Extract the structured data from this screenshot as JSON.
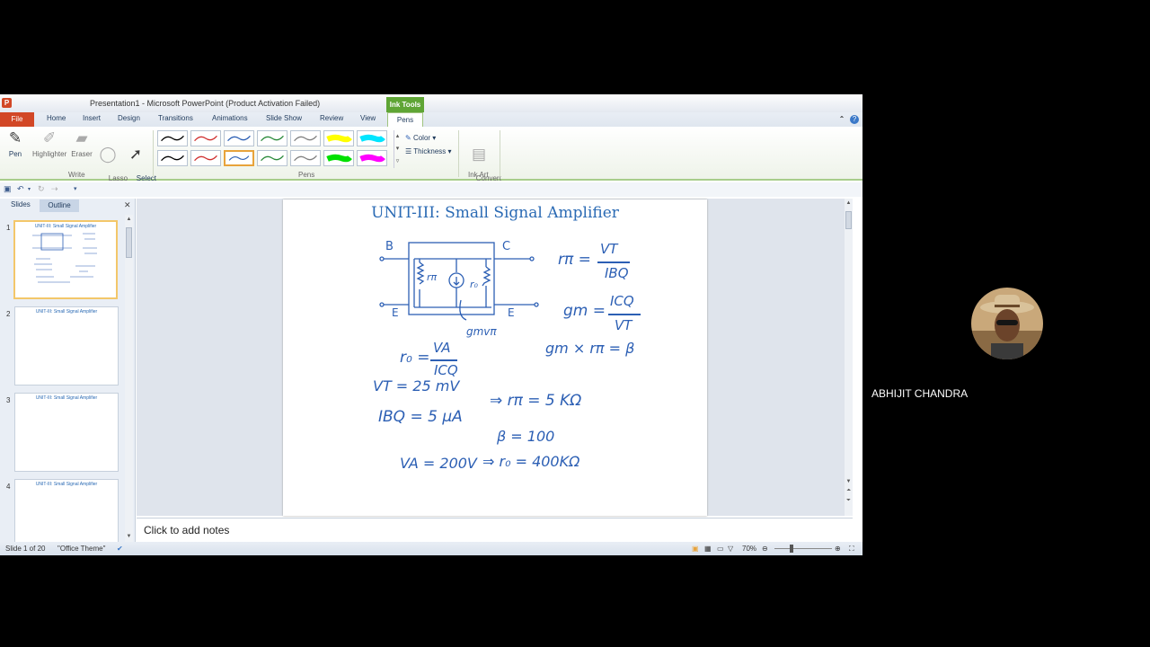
{
  "window": {
    "title": "Presentation1 - Microsoft PowerPoint (Product Activation Failed)",
    "contextual_tab_group": "Ink Tools"
  },
  "tabs": [
    "File",
    "Home",
    "Insert",
    "Design",
    "Transitions",
    "Animations",
    "Slide Show",
    "Review",
    "View",
    "Pens"
  ],
  "ribbon": {
    "write_group": {
      "label": "Write",
      "buttons": [
        "Pen",
        "Highlighter",
        "Eraser",
        "Lasso\nSelect",
        "Select\nObjects"
      ]
    },
    "pens_group": {
      "label": "Pens",
      "color_label": "Color",
      "thickness_label": "Thickness"
    },
    "ink_art_group": {
      "label": "Ink Art",
      "convert_label": "Convert\nto Shapes"
    },
    "pen_colors": [
      "#000000",
      "#d03030",
      "#2c5fb4",
      "#2a8a3a",
      "#808080",
      "#000000",
      "#d03030",
      "#2c5fb4",
      "#2a8a3a",
      "#808080"
    ],
    "highlighter_colors": [
      "#ffff00",
      "#00e5ff",
      "#00e000",
      "#ff00ff"
    ]
  },
  "slides_pane": {
    "tabs": [
      "Slides",
      "Outline"
    ],
    "thumbnails": [
      {
        "number": "1",
        "title": "UNIT-III: Small Signal Amplifier"
      },
      {
        "number": "2",
        "title": "UNIT-III: Small Signal Amplifier"
      },
      {
        "number": "3",
        "title": "UNIT-III: Small Signal Amplifier"
      },
      {
        "number": "4",
        "title": "UNIT-III: Small Signal Amplifier"
      }
    ]
  },
  "slide": {
    "title": "UNIT-III: Small Signal Amplifier",
    "circuit": {
      "b": "B",
      "c": "C",
      "e_left": "E",
      "e_right": "E",
      "r_pi": "rπ",
      "r_o": "r₀",
      "source": "gmvπ"
    },
    "equations": {
      "r_pi_lhs": "rπ =",
      "r_pi_num": "VT",
      "r_pi_den": "IBQ",
      "gm_lhs": "gm =",
      "gm_num": "ICQ",
      "gm_den": "VT",
      "product": "gm × rπ = β",
      "ro_lhs": "r₀ =",
      "ro_num": "VA",
      "ro_den": "ICQ",
      "vt": "VT = 25 mV",
      "ibq": "IBQ = 5 μA",
      "rpi_result": "⇒ rπ = 5 KΩ",
      "beta": "β = 100",
      "va": "VA = 200V",
      "ro_result": "⇒ r₀ = 400KΩ"
    }
  },
  "notes": {
    "placeholder": "Click to add notes"
  },
  "status": {
    "slide": "Slide 1 of 20",
    "theme": "\"Office Theme\"",
    "zoom": "70%"
  },
  "participant": {
    "name": "ABHIJIT CHANDRA"
  }
}
